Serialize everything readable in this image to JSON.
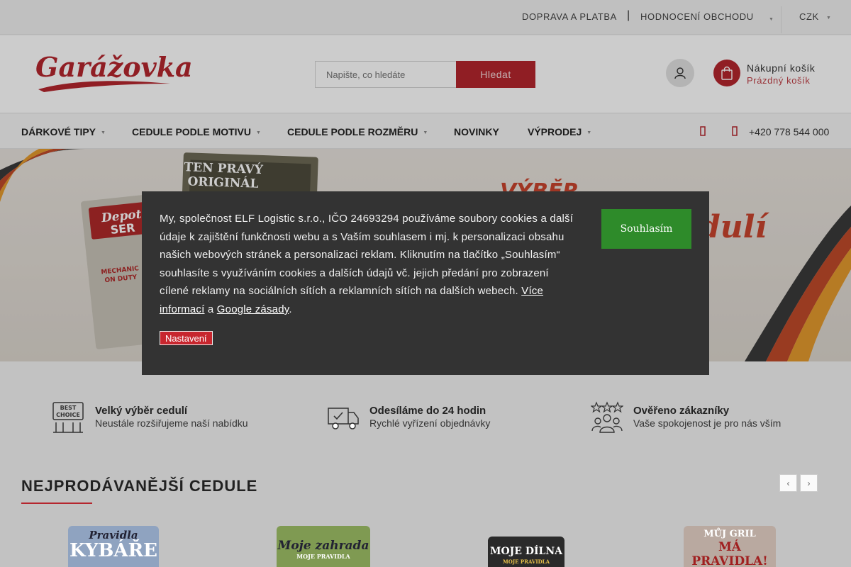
{
  "topbar": {
    "links": [
      "DOPRAVA A PLATBA",
      "HODNOCENÍ OBCHODU"
    ],
    "separator": "|",
    "currency": "CZK"
  },
  "header": {
    "logo_text": "Garážovka",
    "search_placeholder": "Napište, co hledáte",
    "search_button": "Hledat",
    "cart_title": "Nákupní košík",
    "cart_status": "Prázdný košík"
  },
  "nav": {
    "items": [
      {
        "label": "DÁRKOVÉ TIPY",
        "has_dropdown": true
      },
      {
        "label": "CEDULE PODLE MOTIVU",
        "has_dropdown": true
      },
      {
        "label": "CEDULE PODLE ROZMĚRU",
        "has_dropdown": true
      },
      {
        "label": "NOVINKY",
        "has_dropdown": false
      },
      {
        "label": "VÝPRODEJ",
        "has_dropdown": true
      }
    ],
    "phone": "+420 778 544 000"
  },
  "banner": {
    "sign_text_1": "TEN PRAVÝ",
    "sign_text_2": "ORIGINÁL",
    "sign_depot_1": "Depot",
    "sign_depot_2": "SER",
    "sign_mechanic_1": "MECHANIC",
    "sign_mechanic_2": "ON DUTY",
    "headline_1": "VÝBĚR",
    "headline_2": "dulí"
  },
  "benefits": [
    {
      "icon": "best-choice-icon",
      "icon_text_1": "BEST",
      "icon_text_2": "CHOICE",
      "title": "Velký výběr cedulí",
      "subtitle": "Neustále rozšiřujeme naší nabídku"
    },
    {
      "icon": "delivery-truck-icon",
      "title": "Odesíláme do 24 hodin",
      "subtitle": "Rychlé vyřízení objednávky"
    },
    {
      "icon": "verified-customers-icon",
      "title": "Ověřeno zákazníky",
      "subtitle": "Vaše spokojenost je pro nás vším"
    }
  ],
  "section": {
    "title": "NEJPRODÁVANĚJŠÍ CEDULE",
    "prev": "‹",
    "next": "›"
  },
  "products": [
    {
      "line1": "Pravidla",
      "line2": "KYBÁŘE"
    },
    {
      "line1": "Moje zahrada",
      "line2": "MOJE PRAVIDLA"
    },
    {
      "line1": "MOJE DÍLNA",
      "line2": "MOJE PRAVIDLA"
    },
    {
      "line1": "MŮJ GRIL",
      "line2": "MÁ PRAVIDLA!"
    }
  ],
  "cookie": {
    "text_main": "My, společnost ELF Logistic s.r.o., IČO 24693294 používáme soubory cookies a další údaje k zajištění funkčnosti webu a s Vaším souhlasem i mj. k personalizaci obsahu našich webových stránek a personalizaci reklam. Kliknutím na tlačítko „Souhlasím“ souhlasíte s využíváním cookies a dalších údajů vč. jejich předání pro zobrazení cílené reklamy na sociálních sítích a reklamních sítích na dalších webech. ",
    "link_more": "Více informací",
    "and": " a ",
    "link_google": "Google zásady",
    "period": ".",
    "accept_button": "Souhlasím",
    "settings_button": "Nastavení"
  },
  "colors": {
    "brand": "#b5262e",
    "accept": "#2e8b2a",
    "modal": "#333333"
  }
}
